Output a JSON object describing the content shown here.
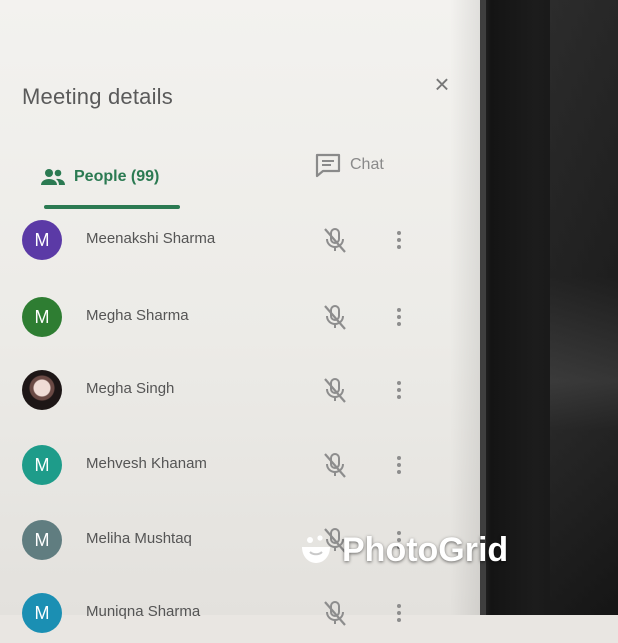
{
  "panel": {
    "title": "Meeting details",
    "close_icon": "close-icon"
  },
  "tabs": {
    "people_label": "People (99)",
    "people_icon": "people-icon",
    "chat_label": "Chat",
    "chat_icon": "chat-icon",
    "active": "people",
    "accent_color": "#2b7a52"
  },
  "participants": [
    {
      "name": "Meenakshi Sharma",
      "avatar_text": "M",
      "avatar_color": "#5b3aa6",
      "muted": true
    },
    {
      "name": "Megha Sharma",
      "avatar_text": "M",
      "avatar_color": "#2e7d32",
      "muted": true
    },
    {
      "name": "Megha Singh",
      "avatar_text": "",
      "avatar_color": "#1d1616",
      "muted": true
    },
    {
      "name": "Mehvesh Khanam",
      "avatar_text": "M",
      "avatar_color": "#1e9c8a",
      "muted": true
    },
    {
      "name": "Meliha Mushtaq",
      "avatar_text": "M",
      "avatar_color": "#607d80",
      "muted": true
    },
    {
      "name": "Muniqna Sharma",
      "avatar_text": "M",
      "avatar_color": "#1b8fb3",
      "muted": true
    }
  ],
  "watermark": {
    "text": "PhotoGrid"
  }
}
